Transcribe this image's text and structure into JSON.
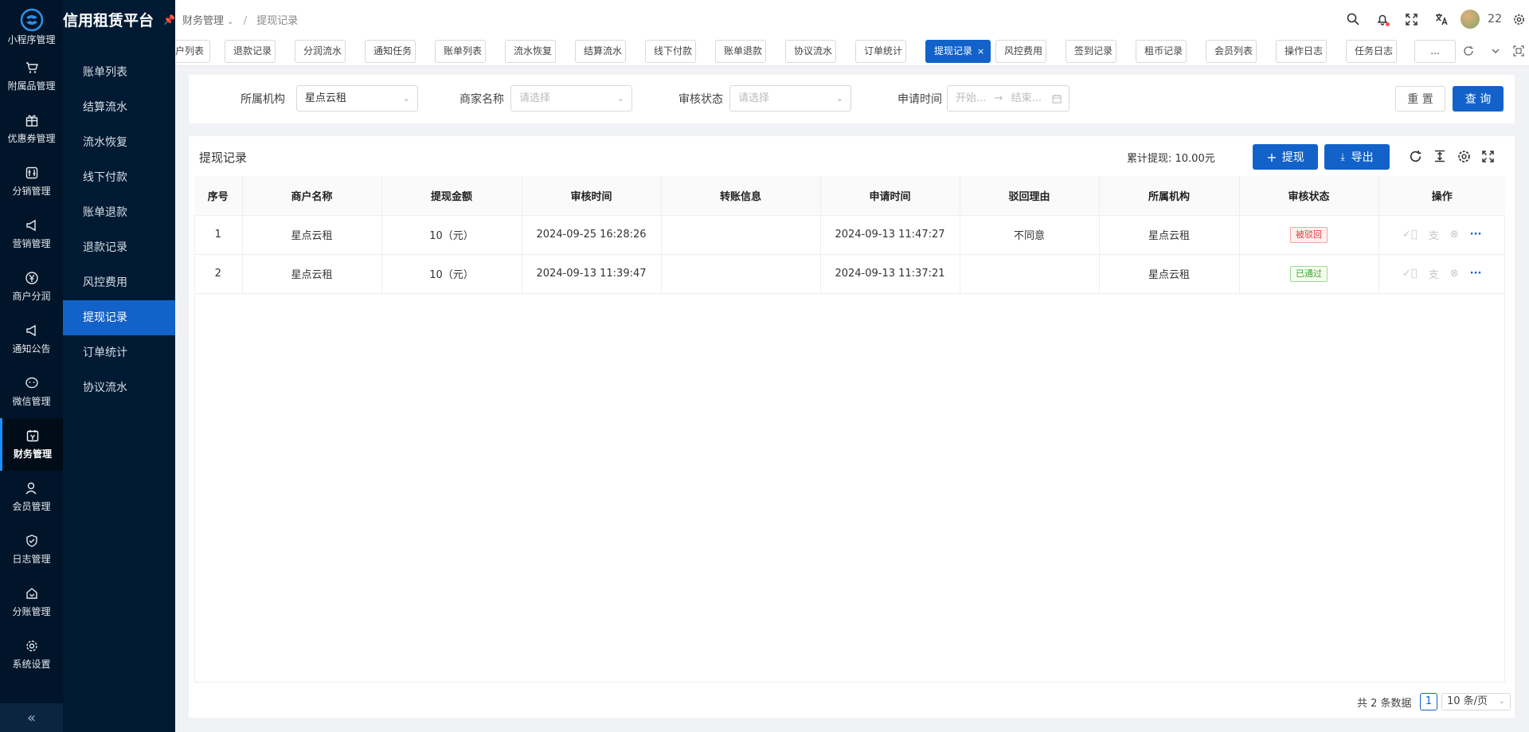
{
  "brand": {
    "title": "信用租赁平台"
  },
  "rail": {
    "first_label": "小程序管理",
    "items": [
      {
        "label": "附属品管理",
        "icon": "cart-icon"
      },
      {
        "label": "优惠券管理",
        "icon": "gift-icon"
      },
      {
        "label": "分销管理",
        "icon": "distribution-icon"
      },
      {
        "label": "营销管理",
        "icon": "megaphone-icon"
      },
      {
        "label": "商户分润",
        "icon": "yen-circle-icon"
      },
      {
        "label": "通知公告",
        "icon": "megaphone-icon"
      },
      {
        "label": "微信管理",
        "icon": "wechat-icon"
      },
      {
        "label": "财务管理",
        "icon": "finance-icon"
      },
      {
        "label": "会员管理",
        "icon": "member-icon"
      },
      {
        "label": "日志管理",
        "icon": "shield-check-icon"
      },
      {
        "label": "分账管理",
        "icon": "split-icon"
      },
      {
        "label": "系统设置",
        "icon": "gear-icon"
      }
    ],
    "active": "财务管理",
    "collapse": "«"
  },
  "submenu": {
    "items": [
      "账单列表",
      "结算流水",
      "流水恢复",
      "线下付款",
      "账单退款",
      "退款记录",
      "风控费用",
      "提现记录",
      "订单统计",
      "协议流水"
    ],
    "active": "提现记录"
  },
  "header": {
    "breadcrumb_parent": "财务管理",
    "breadcrumb_current": "提现记录",
    "username": "22"
  },
  "tabs": {
    "items": [
      "户列表",
      "退款记录",
      "分润流水",
      "通知任务",
      "账单列表",
      "流水恢复",
      "结算流水",
      "线下付款",
      "账单退款",
      "协议流水",
      "订单统计",
      "提现记录",
      "风控费用",
      "签到记录",
      "租币记录",
      "会员列表",
      "操作日志",
      "任务日志",
      "..."
    ],
    "active": "提现记录",
    "close": "×"
  },
  "filter": {
    "org_label": "所属机构",
    "org_value": "星点云租",
    "merchant_label": "商家名称",
    "merchant_placeholder": "请选择",
    "status_label": "审核状态",
    "status_placeholder": "请选择",
    "time_label": "申请时间",
    "time_start_placeholder": "开始...",
    "time_end_placeholder": "结束...",
    "reset": "重 置",
    "query": "查 询"
  },
  "card": {
    "title": "提现记录",
    "total": "累计提现: 10.00元",
    "withdraw_btn": "提现",
    "export_btn": "导出"
  },
  "table": {
    "columns": [
      "序号",
      "商户名称",
      "提现金额",
      "审核时间",
      "转账信息",
      "申请时间",
      "驳回理由",
      "所属机构",
      "审核状态",
      "操作"
    ],
    "rows": [
      {
        "idx": "1",
        "merchant": "星点云租",
        "amount": "10（元）",
        "audit_time": "2024-09-25 16:28:26",
        "transfer": "",
        "apply_time": "2024-09-13 11:47:27",
        "reason": "不同意",
        "org": "星点云租",
        "status": "被驳回",
        "status_color": "#e03a3a"
      },
      {
        "idx": "2",
        "merchant": "星点云租",
        "amount": "10（元）",
        "audit_time": "2024-09-13 11:39:47",
        "transfer": "",
        "apply_time": "2024-09-13 11:37:21",
        "reason": "",
        "org": "星点云租",
        "status": "已通过",
        "status_color": "#3aa435"
      }
    ]
  },
  "pagination": {
    "total_text": "共 2 条数据",
    "current": "1",
    "page_size": "10 条/页"
  },
  "colors": {
    "primary": "#1262c9",
    "sidebar": "#001529"
  }
}
